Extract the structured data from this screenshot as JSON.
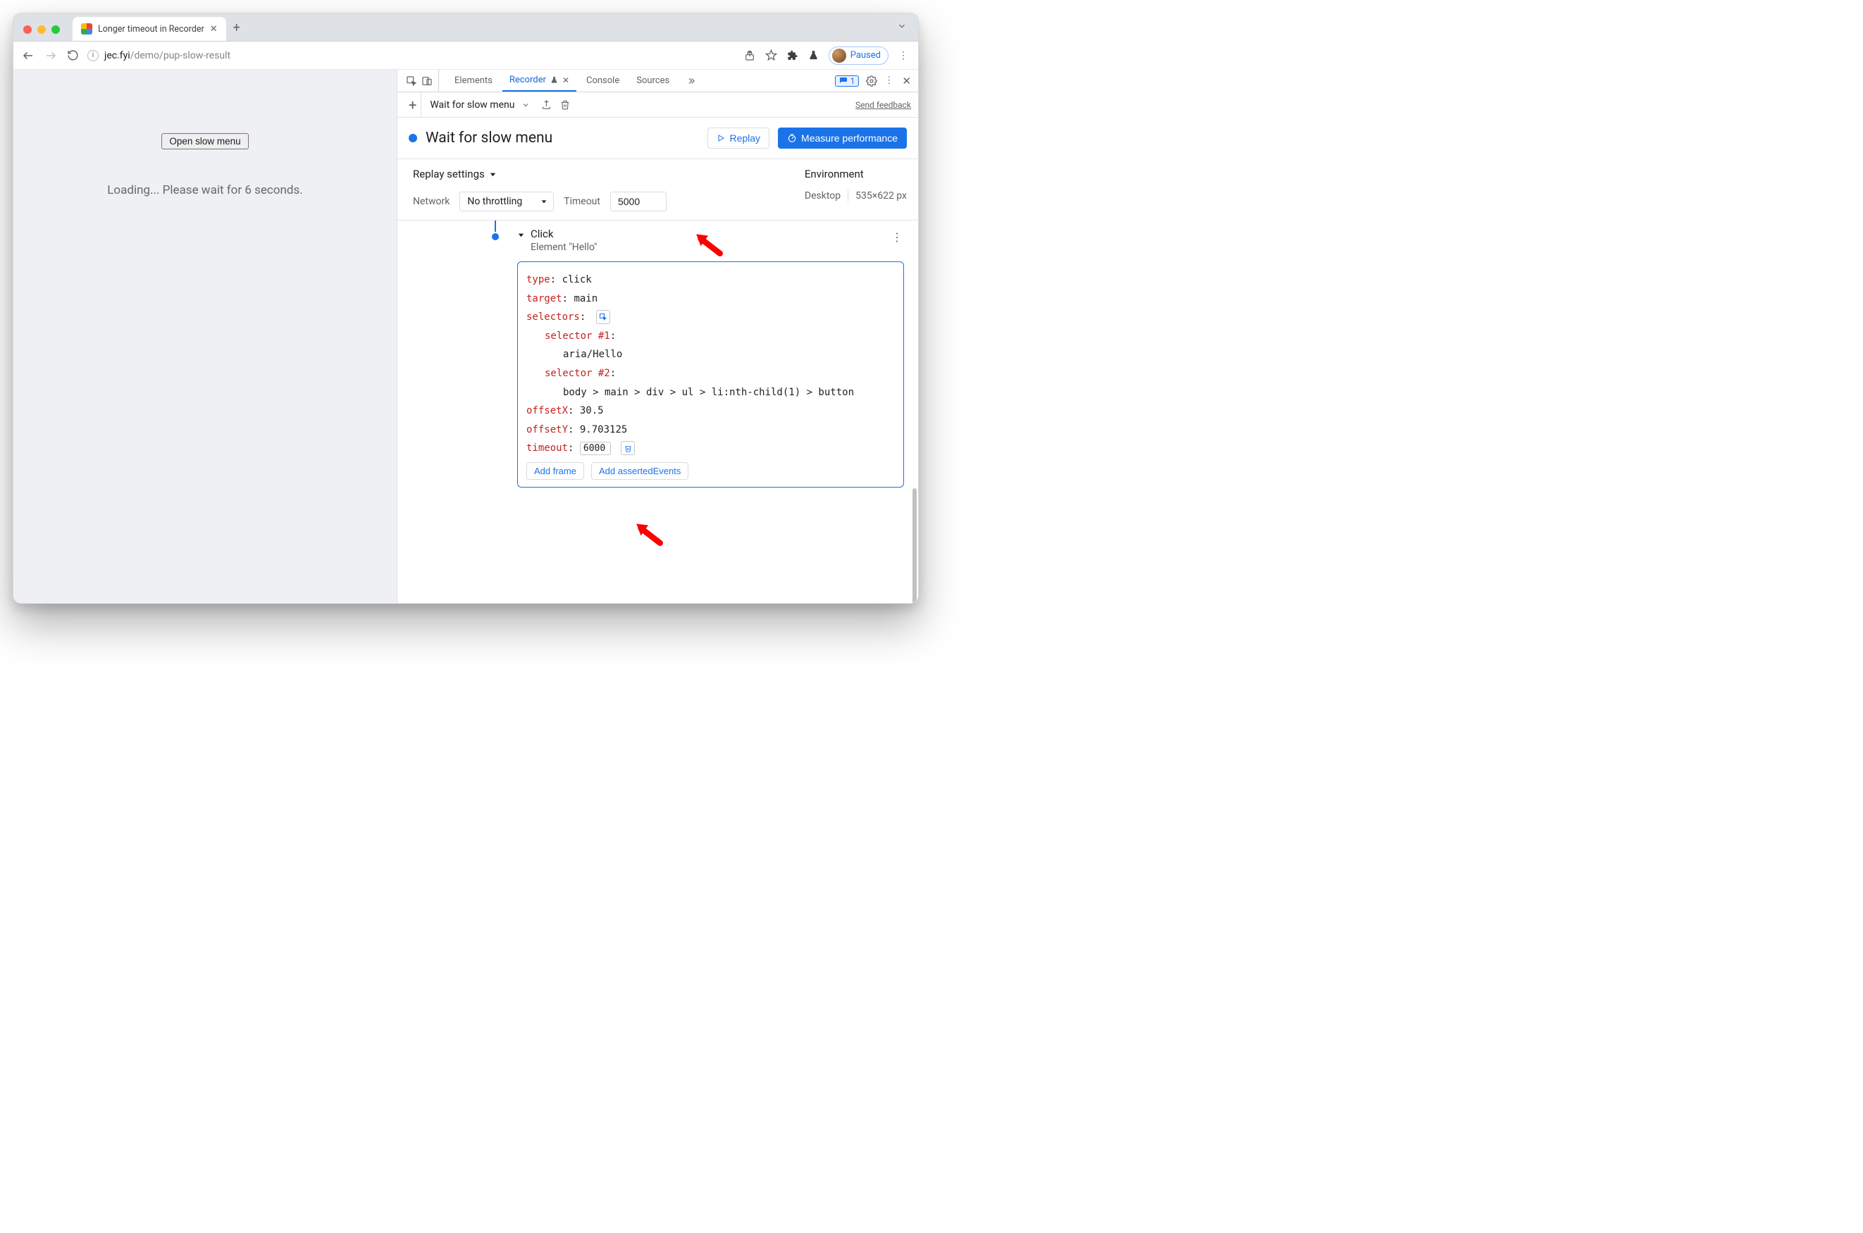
{
  "tab": {
    "title": "Longer timeout in Recorder"
  },
  "url": {
    "host": "jec.fyi",
    "path": "/demo/pup-slow-result"
  },
  "profile_chip": "Paused",
  "page_content": {
    "button_label": "Open slow menu",
    "loading_text": "Loading... Please wait for 6 seconds."
  },
  "devtools": {
    "tabs": {
      "elements": "Elements",
      "recorder": "Recorder",
      "console": "Console",
      "sources": "Sources"
    },
    "issues_count": "1",
    "subbar": {
      "recording_name": "Wait for slow menu",
      "feedback": "Send feedback"
    },
    "header": {
      "title": "Wait for slow menu",
      "replay": "Replay",
      "measure": "Measure performance"
    },
    "settings": {
      "title": "Replay settings",
      "network_label": "Network",
      "throttling_value": "No throttling",
      "timeout_label": "Timeout",
      "timeout_value": "5000",
      "env_title": "Environment",
      "env_device": "Desktop",
      "env_size": "535×622 px"
    },
    "step": {
      "title": "Click",
      "subtitle": "Element \"Hello\"",
      "type_key": "type",
      "type_val": "click",
      "target_key": "target",
      "target_val": "main",
      "selectors_key": "selectors",
      "sel1_key": "selector #1",
      "sel1_val": "aria/Hello",
      "sel2_key": "selector #2",
      "sel2_val": "body > main > div > ul > li:nth-child(1) > button",
      "offx_key": "offsetX",
      "offx_val": "30.5",
      "offy_key": "offsetY",
      "offy_val": "9.703125",
      "timeout_key": "timeout",
      "timeout_val": "6000",
      "add_frame": "Add frame",
      "add_asserted": "Add assertedEvents"
    }
  }
}
